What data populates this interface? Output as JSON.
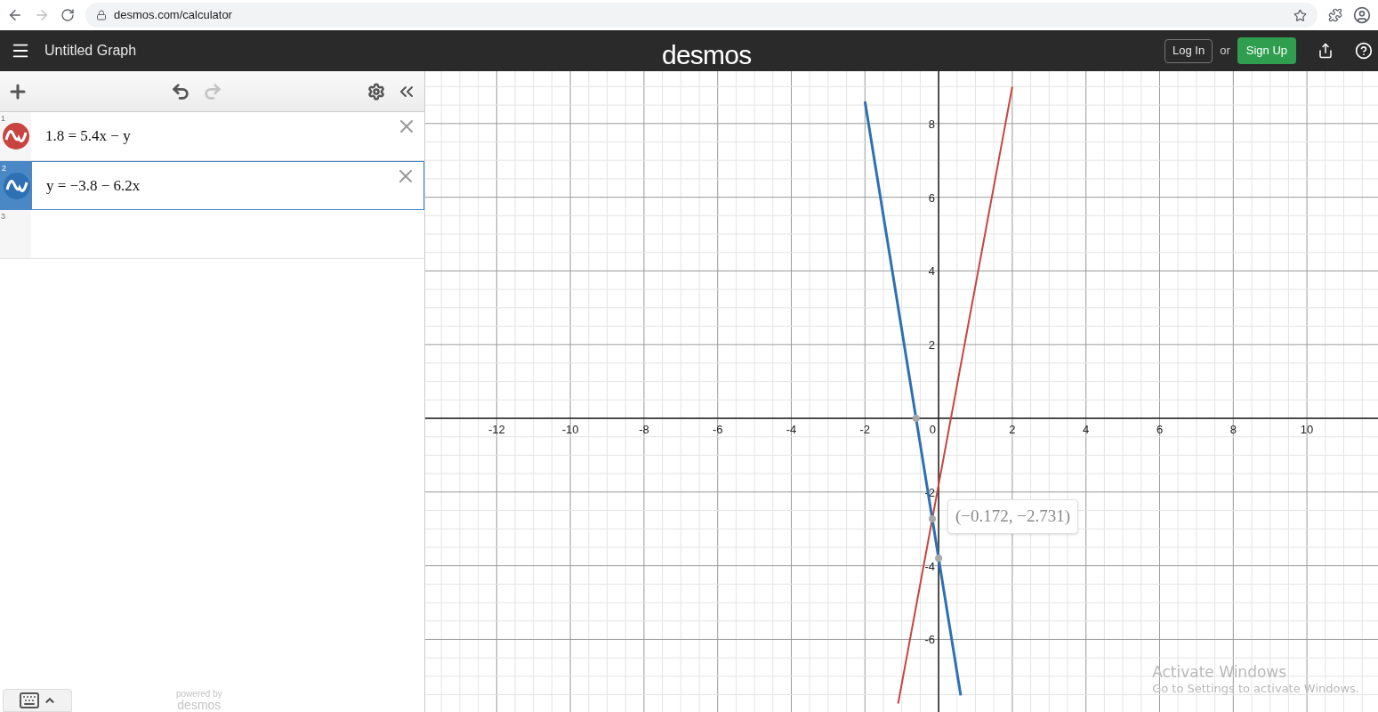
{
  "browser": {
    "url": "desmos.com/calculator"
  },
  "header": {
    "title": "Untitled Graph",
    "logo": "desmos",
    "login": "Log In",
    "or": "or",
    "signup": "Sign Up"
  },
  "expressions": [
    {
      "number": "1",
      "color": "#c74440",
      "latex": "1.8 = 5.4x − y",
      "selected": false
    },
    {
      "number": "2",
      "color": "#2d70b3",
      "latex": "y = −3.8 − 6.2x",
      "selected": true
    },
    {
      "number": "3"
    }
  ],
  "footer": {
    "powered_by": "powered by",
    "logo": "desmos"
  },
  "graph": {
    "chart_data": {
      "type": "line",
      "x": [
        -2,
        -1.1,
        0.6,
        2
      ],
      "series": [
        {
          "color": "#c74440",
          "values": [
            null,
            -7.74,
            1.44,
            9.0
          ]
        },
        {
          "color": "#2d70b3",
          "values": [
            8.6,
            3.02,
            -7.52,
            null
          ]
        }
      ],
      "xlim": [
        -13.94,
        11.93
      ],
      "ylim": [
        -7.97,
        9.42
      ],
      "xticks": [
        -12,
        -10,
        -8,
        -6,
        -4,
        -2,
        0,
        2,
        4,
        6,
        8,
        10
      ],
      "yticks": [
        -6,
        -4,
        -2,
        2,
        4,
        6,
        8
      ],
      "grid": true,
      "annotations": [
        {
          "x": -0.172,
          "y": -2.731,
          "text": "(−0.172, −2.731)"
        }
      ]
    }
  },
  "os_notice": {
    "title": "Activate Windows",
    "text": "Go to Settings to activate Windows."
  }
}
